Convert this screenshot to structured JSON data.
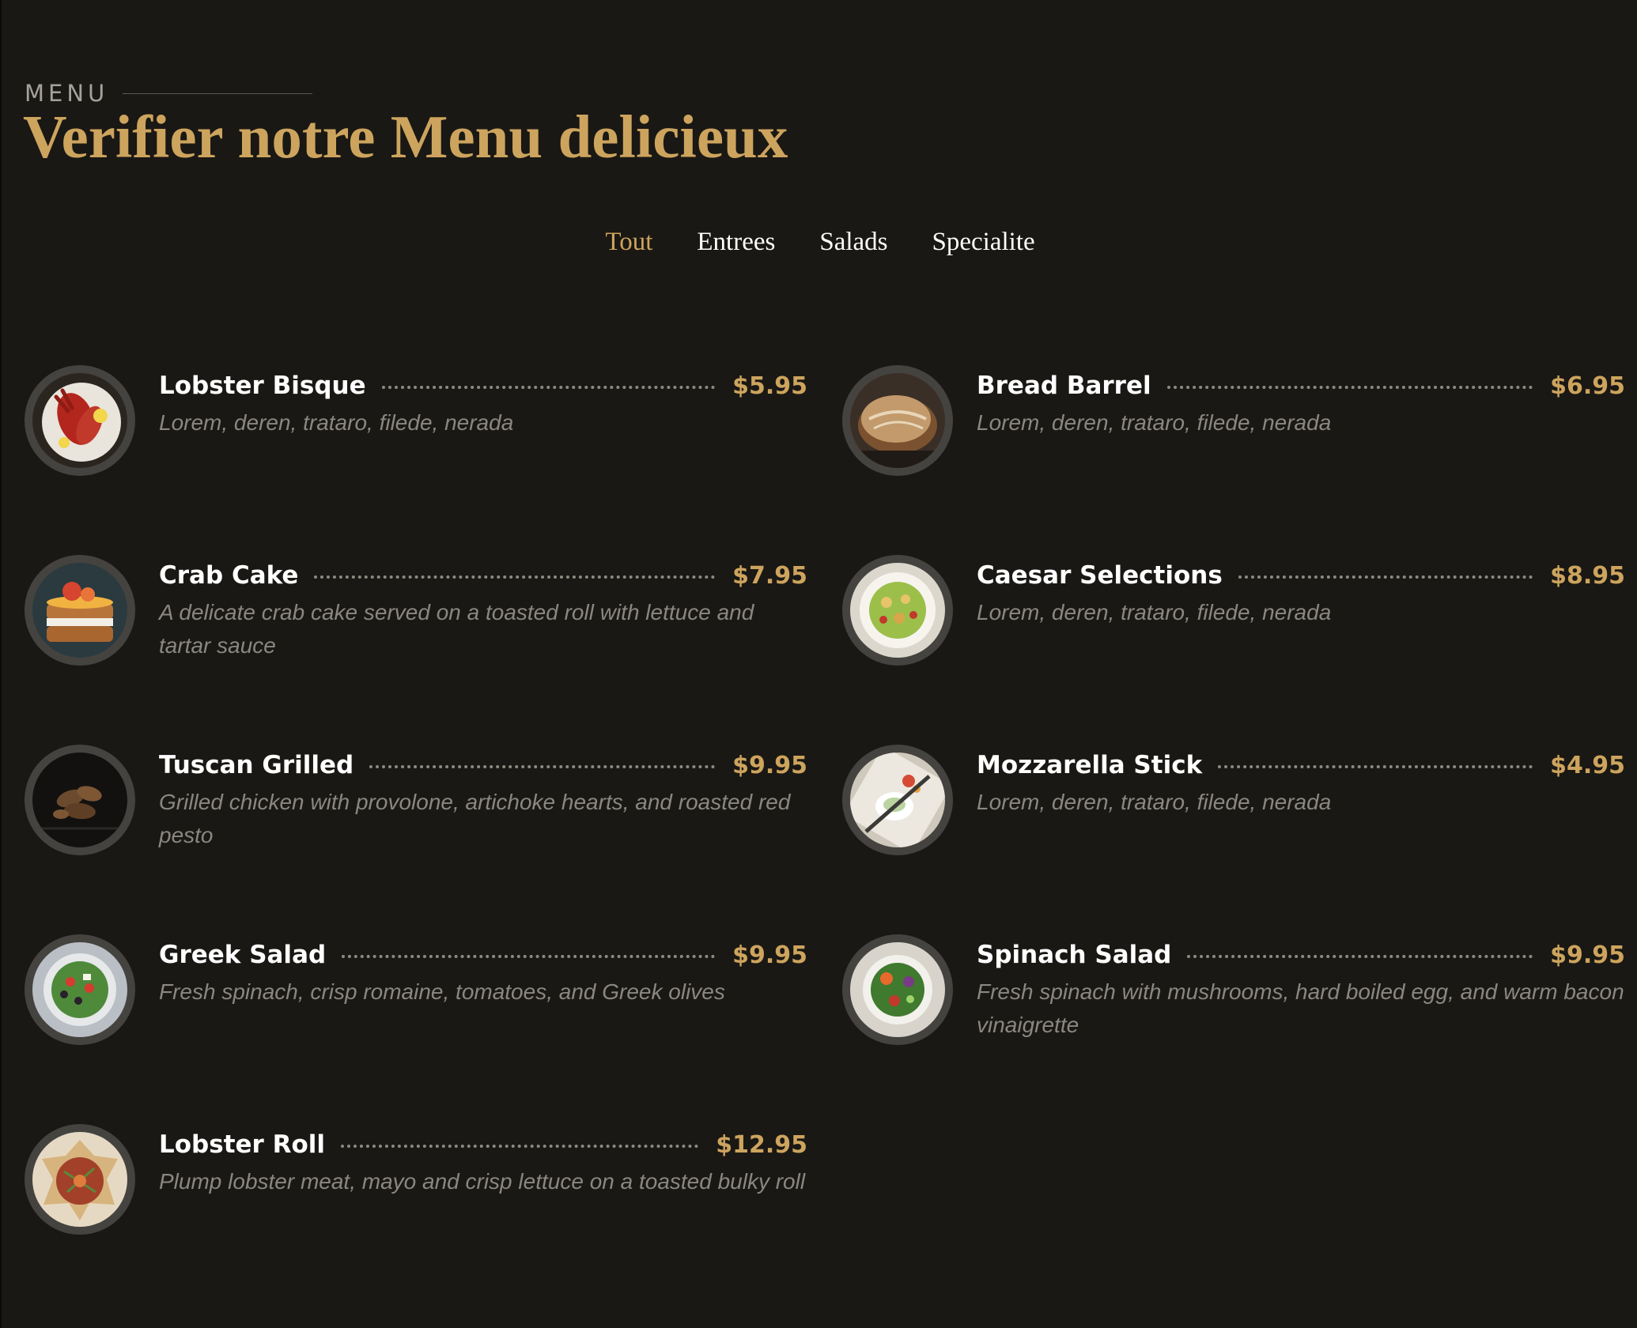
{
  "header": {
    "eyebrow": "MENU",
    "title": "Verifier notre Menu delicieux"
  },
  "tabs": [
    {
      "label": "Tout",
      "active": true
    },
    {
      "label": "Entrees",
      "active": false
    },
    {
      "label": "Salads",
      "active": false
    },
    {
      "label": "Specialite",
      "active": false
    }
  ],
  "colors": {
    "background": "#1a1814",
    "accent": "#cda45e",
    "text": "#ffffff",
    "muted": "#8a8781"
  },
  "items": [
    {
      "name": "Lobster Bisque",
      "price": "$5.95",
      "description": "Lorem, deren, trataro, filede, nerada",
      "image": "lobster-image"
    },
    {
      "name": "Bread Barrel",
      "price": "$6.95",
      "description": "Lorem, deren, trataro, filede, nerada",
      "image": "bread-image"
    },
    {
      "name": "Crab Cake",
      "price": "$7.95",
      "description": "A delicate crab cake served on a toasted roll with lettuce and tartar sauce",
      "image": "crab-cake-image"
    },
    {
      "name": "Caesar Selections",
      "price": "$8.95",
      "description": "Lorem, deren, trataro, filede, nerada",
      "image": "caesar-salad-image"
    },
    {
      "name": "Tuscan Grilled",
      "price": "$9.95",
      "description": "Grilled chicken with provolone, artichoke hearts, and roasted red pesto",
      "image": "grilled-chicken-image"
    },
    {
      "name": "Mozzarella Stick",
      "price": "$4.95",
      "description": "Lorem, deren, trataro, filede, nerada",
      "image": "mozzarella-image"
    },
    {
      "name": "Greek Salad",
      "price": "$9.95",
      "description": "Fresh spinach, crisp romaine, tomatoes, and Greek olives",
      "image": "greek-salad-image"
    },
    {
      "name": "Spinach Salad",
      "price": "$9.95",
      "description": "Fresh spinach with mushrooms, hard boiled egg, and warm bacon vinaigrette",
      "image": "spinach-salad-image"
    },
    {
      "name": "Lobster Roll",
      "price": "$12.95",
      "description": "Plump lobster meat, mayo and crisp lettuce on a toasted bulky roll",
      "image": "lobster-roll-image"
    }
  ]
}
